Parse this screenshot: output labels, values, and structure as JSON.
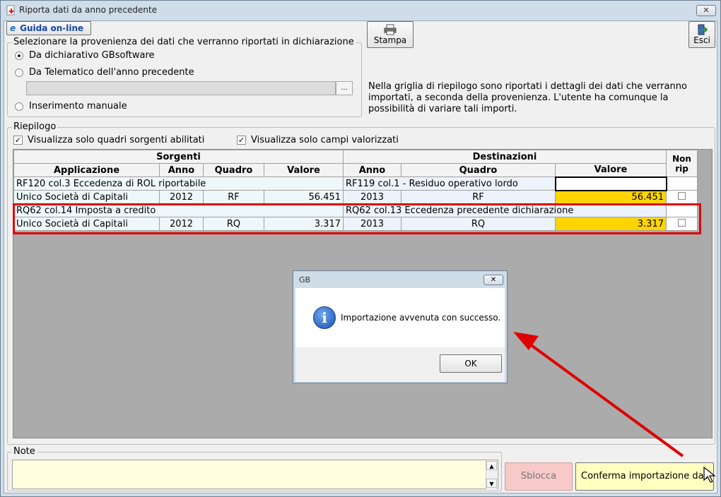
{
  "window": {
    "title": "Riporta dati da anno precedente",
    "close_glyph": "✕"
  },
  "toolbar": {
    "guida_label": "Guida on-line",
    "guida_glyph": "e",
    "stampa_label": "Stampa",
    "esci_label": "Esci"
  },
  "provenienza": {
    "legend": "Selezionare la provenienza dei dati che verranno riportati in dichiarazione",
    "options": [
      "Da dichiarativo GBsoftware",
      "Da Telematico dell'anno precedente",
      "Inserimento manuale"
    ],
    "selected_index": 0,
    "path_value": "",
    "browse_label": "..."
  },
  "info_text": "Nella griglia di riepilogo sono riportati i dettagli dei dati che verranno importati, a seconda della provenienza. L'utente ha comunque la possibilità di variare tali importi.",
  "riepilogo": {
    "legend": "Riepilogo",
    "check1_label": "Visualizza solo quadri sorgenti abilitati",
    "check1_checked": true,
    "check2_label": "Visualizza solo campi valorizzati",
    "check2_checked": true,
    "check_glyph": "✓"
  },
  "grid": {
    "group_sorgenti": "Sorgenti",
    "group_destinazioni": "Destinazioni",
    "col_nonrip": "Non rip",
    "headers": [
      "Applicazione",
      "Anno",
      "Quadro",
      "Valore",
      "Anno",
      "Quadro",
      "Valore"
    ],
    "rows": [
      {
        "src_desc": "RF120 col.3 Eccedenza di ROL riportabile",
        "dst_desc": "RF119 col.1 - Residuo operativo lordo",
        "app": "Unico Società di Capitali",
        "src_anno": "2012",
        "src_quadro": "RF",
        "src_valore": "56.451",
        "dst_anno": "2013",
        "dst_quadro": "RF",
        "dst_valore": "56.451",
        "non_rip": false
      },
      {
        "src_desc": "RQ62 col.14 Imposta a credito",
        "dst_desc": "RQ62 col.13 Eccedenza precedente dichiarazione",
        "app": "Unico Società di Capitali",
        "src_anno": "2012",
        "src_quadro": "RQ",
        "src_valore": "3.317",
        "dst_anno": "2013",
        "dst_quadro": "RQ",
        "dst_valore": "3.317",
        "non_rip": false
      }
    ]
  },
  "note": {
    "legend": "Note",
    "value": ""
  },
  "actions": {
    "sblocca_label": "Sblocca",
    "conferma_label": "Conferma importazione dati"
  },
  "dialog": {
    "title": "GB",
    "message": "Importazione avvenuta con successo.",
    "ok_label": "OK",
    "icon_glyph": "i",
    "close_glyph": "✕"
  },
  "colors": {
    "highlight": "#e00000",
    "value_cell": "#ffd400",
    "note_bg": "#ffffe0",
    "conferma_bg": "#ffffc0",
    "sblocca_bg": "#f8c9c9"
  }
}
